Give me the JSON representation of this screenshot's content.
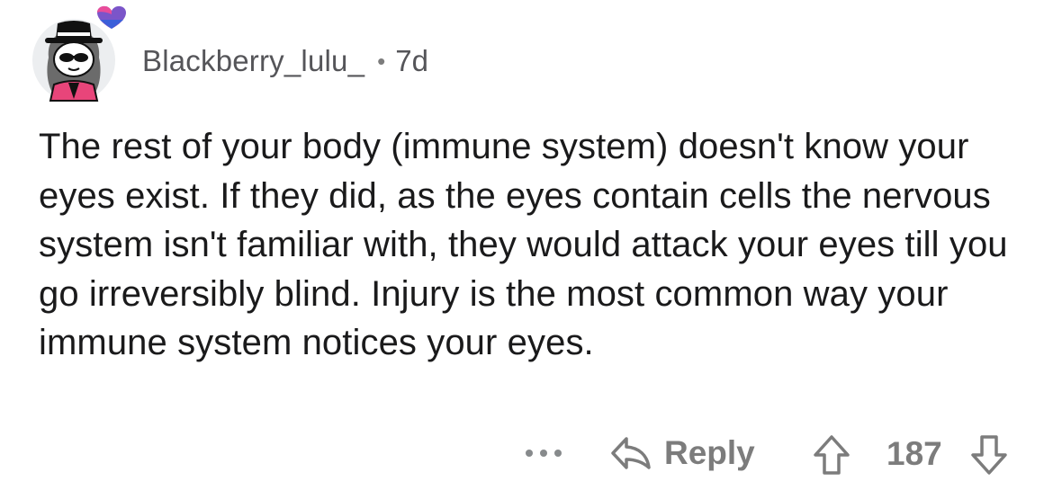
{
  "comment": {
    "author": {
      "username": "Blackberry_lulu_",
      "separator": "•",
      "age": "7d",
      "avatar_icon": "snoo-avatar-with-hat-and-sunglasses-icon",
      "flair_icon": "heart-icon"
    },
    "body": "The rest of your body (immune system) doesn't know your eyes exist. If they did, as the eyes contain cells the nervous system isn't familiar with, they would attack your eyes till you go irreversibly blind. Injury is the most common way your immune system notices your eyes.",
    "actions": {
      "more_icon": "more-options-icon",
      "reply_icon": "reply-arrow-icon",
      "reply_label": "Reply",
      "upvote_icon": "upvote-arrow-icon",
      "score": "187",
      "downvote_icon": "downvote-arrow-icon"
    }
  },
  "colors": {
    "text": "#1a1a1b",
    "meta_text": "#555559",
    "action_gray": "#7c7c7c",
    "heart_pink": "#e94c9a",
    "heart_purple": "#7b55c9",
    "heart_blue": "#3b5fd9",
    "avatar_bg": "#eceef0",
    "jacket_pink": "#e8457a"
  }
}
